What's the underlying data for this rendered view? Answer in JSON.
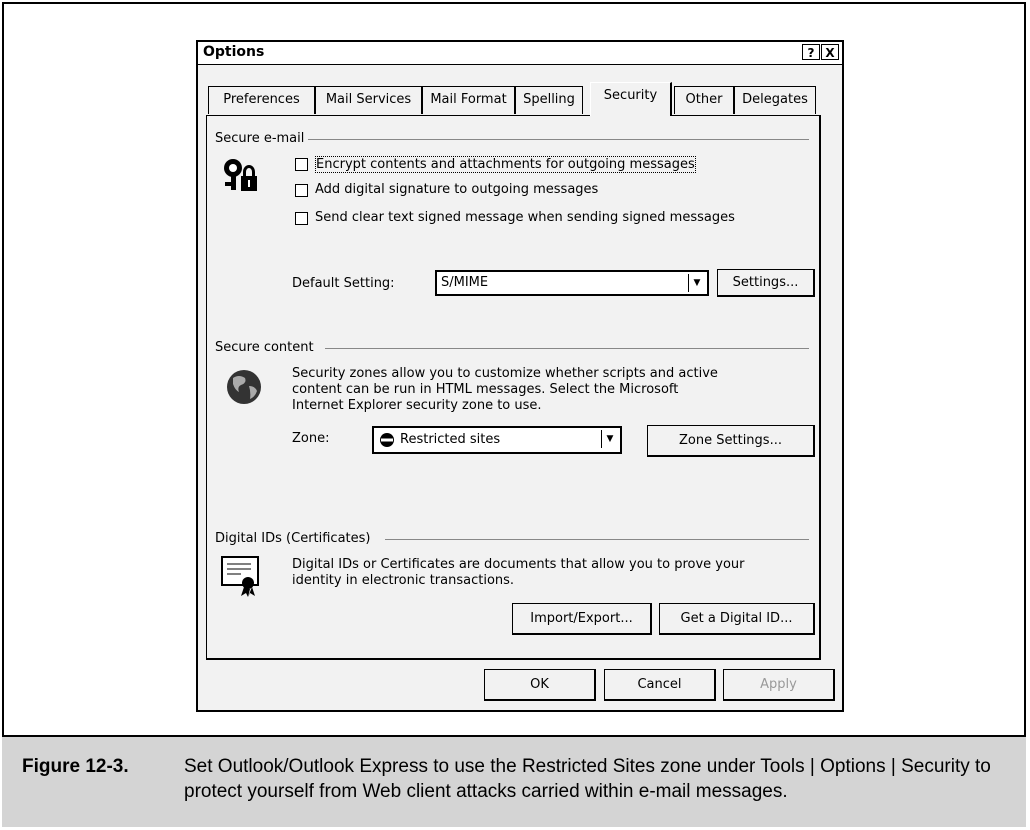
{
  "dialog": {
    "title": "Options",
    "help_label": "?",
    "close_label": "X",
    "tabs": [
      "Preferences",
      "Mail Services",
      "Mail Format",
      "Spelling",
      "Security",
      "Other",
      "Delegates"
    ],
    "active_tab": "Security"
  },
  "secure_email": {
    "heading": "Secure e-mail",
    "checkboxes": [
      "Encrypt contents and attachments for outgoing messages",
      "Add digital signature to outgoing messages",
      "Send clear text signed message when sending signed messages"
    ],
    "default_setting_label": "Default Setting:",
    "default_setting_value": "S/MIME",
    "settings_button": "Settings..."
  },
  "secure_content": {
    "heading": "Secure content",
    "description_lines": [
      "Security zones allow you to customize whether scripts and active",
      "content can be run in HTML messages.  Select the Microsoft",
      "Internet Explorer security zone to use."
    ],
    "zone_label": "Zone:",
    "zone_value": "Restricted sites",
    "zone_settings_button": "Zone Settings..."
  },
  "digital_ids": {
    "heading": "Digital IDs (Certificates)",
    "description_lines": [
      "Digital IDs or Certificates are documents that allow you to prove your",
      "identity in electronic transactions."
    ],
    "import_export_button": "Import/Export...",
    "get_digital_id_button": "Get a Digital ID..."
  },
  "footer": {
    "ok": "OK",
    "cancel": "Cancel",
    "apply": "Apply"
  },
  "caption": {
    "label": "Figure 12-3.",
    "text": "Set Outlook/Outlook Express to use the Restricted Sites zone under Tools | Options | Security to protect yourself from Web client attacks carried within e-mail messages."
  }
}
